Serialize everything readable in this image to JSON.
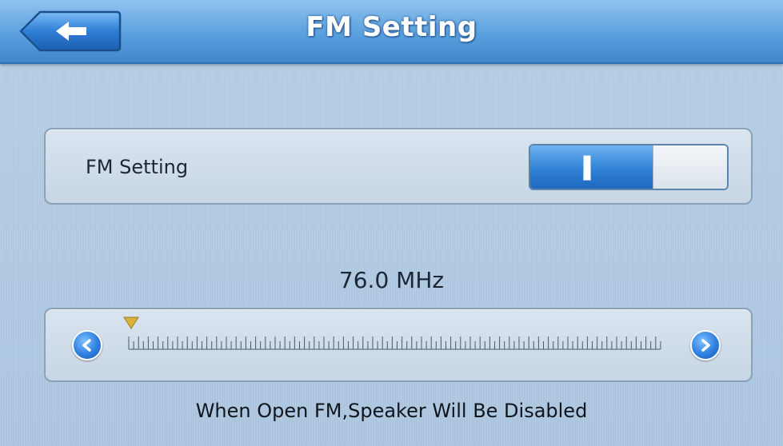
{
  "header": {
    "title": "FM Setting",
    "back_icon": "back-arrow-icon"
  },
  "fm_toggle": {
    "label": "FM Setting",
    "state": "on",
    "on_symbol": "I"
  },
  "tuner": {
    "frequency": "76.0 MHz",
    "position": 0,
    "left_icon": "chevron-left-icon",
    "right_icon": "chevron-right-icon",
    "marker_icon": "frequency-marker-icon"
  },
  "note": "When Open FM,Speaker Will Be Disabled",
  "colors": {
    "header_blue": "#4f96d8",
    "toggle_on_blue": "#2f82d6",
    "marker_yellow": "#d8b23a"
  }
}
